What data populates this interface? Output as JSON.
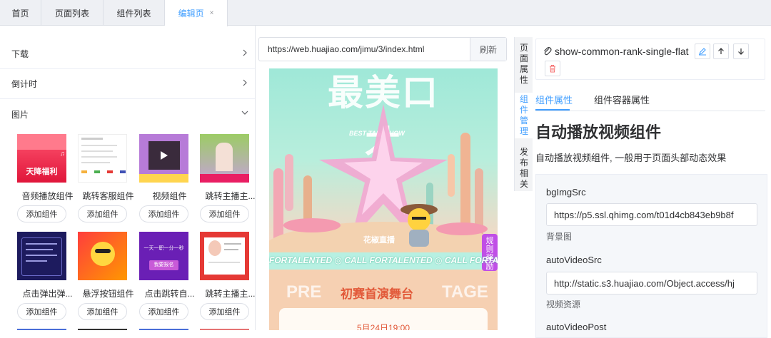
{
  "tabs": [
    {
      "label": "首页"
    },
    {
      "label": "页面列表"
    },
    {
      "label": "组件列表"
    },
    {
      "label": "编辑页",
      "close": "×"
    }
  ],
  "accordion": [
    {
      "label": "下载"
    },
    {
      "label": "倒计时"
    },
    {
      "label": "图片"
    }
  ],
  "components": [
    {
      "label": "音频播放组件",
      "button": "添加组件",
      "thumb_text": "天降福利"
    },
    {
      "label": "跳转客服组件",
      "button": "添加组件"
    },
    {
      "label": "视频组件",
      "button": "添加组件"
    },
    {
      "label": "跳转主播主...",
      "button": "添加组件"
    },
    {
      "label": "点击弹出弹...",
      "button": "添加组件"
    },
    {
      "label": "悬浮按钮组件",
      "button": "添加组件"
    },
    {
      "label": "点击跳转自...",
      "button": "添加组件",
      "thumb_text": "一天一职一分一秒",
      "thumb_sub": "我要报名"
    },
    {
      "label": "跳转主播主...",
      "button": "添加组件"
    }
  ],
  "urlbar": {
    "url": "https://web.huajiao.com/jimu/3/index.html",
    "refresh": "刷新"
  },
  "preview": {
    "headline": "最美口才",
    "badge": "BEST TALKSHOW",
    "brand": "花椒直播",
    "marquee": "FORTALENTED ◎ CALL FORTALENTED ◎ CALL FORTALENTED",
    "stage_left": "PRE",
    "stage_title": "初赛首演舞台",
    "stage_right": "TAGE",
    "side_tag": "规则奖励",
    "date": "5月24日19:00"
  },
  "vtabs": [
    {
      "label": "页面属性"
    },
    {
      "label": "组件管理"
    },
    {
      "label": "发布相关"
    }
  ],
  "right": {
    "component_name": "show-common-rank-single-flat",
    "subtabs": [
      "组件属性",
      "组件容器属性"
    ],
    "title": "自动播放视频组件",
    "description": "自动播放视频组件, 一般用于页面头部动态效果",
    "fields": [
      {
        "label": "bgImgSrc",
        "value": "https://p5.ssl.qhimg.com/t01d4cb843eb9b8f",
        "hint": "背景图"
      },
      {
        "label": "autoVideoSrc",
        "value": "http://static.s3.huajiao.com/Object.access/hj",
        "hint": "视频资源"
      },
      {
        "label": "autoVideoPost"
      }
    ]
  },
  "colors": {
    "accent": "#409eff",
    "danger": "#f56c6c",
    "tab_bar": "#eef0f4"
  }
}
